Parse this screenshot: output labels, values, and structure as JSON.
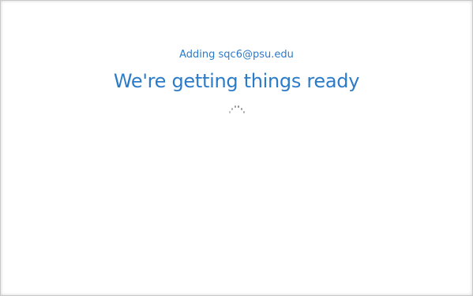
{
  "setup": {
    "account_line": "Adding sqc6@psu.edu",
    "title": "We're getting things ready"
  },
  "colors": {
    "accent": "#2c7bc9",
    "spinner": "#8a8a8a",
    "background": "#ffffff"
  },
  "icons": {
    "spinner": "loading-spinner-icon"
  }
}
